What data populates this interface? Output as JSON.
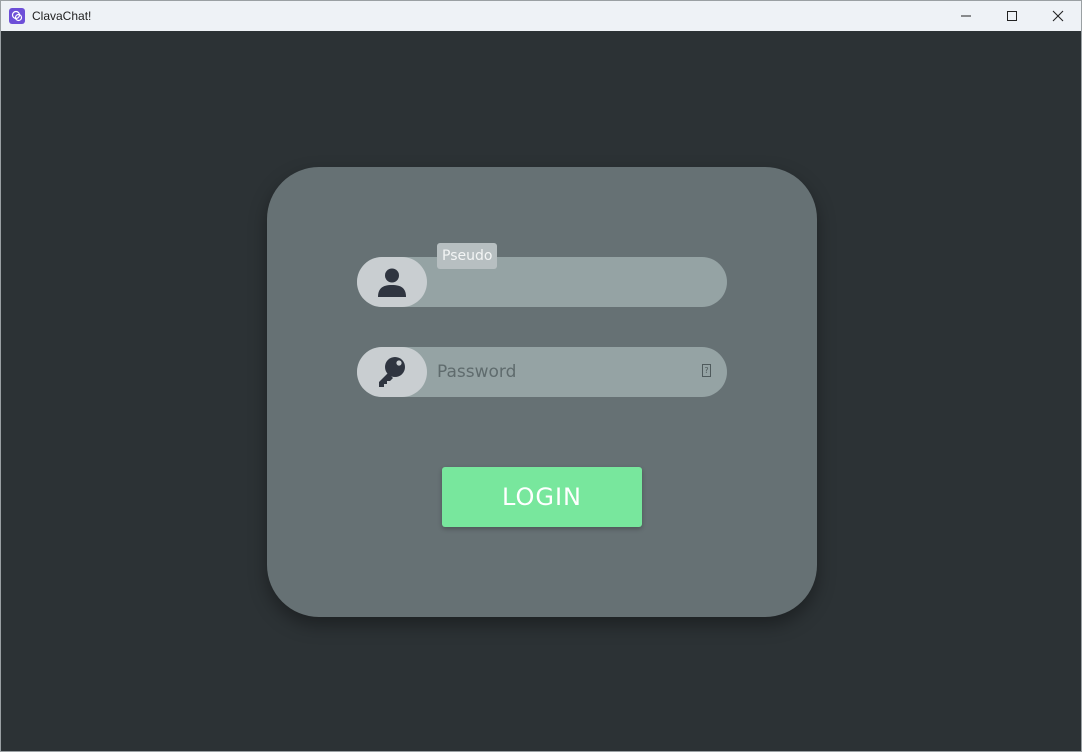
{
  "window": {
    "title": "ClavaChat!",
    "app_icon": "app-logo-icon"
  },
  "controls": {
    "minimize_icon": "minimize-icon",
    "maximize_icon": "maximize-icon",
    "close_icon": "close-icon"
  },
  "login": {
    "username_label": "Pseudo",
    "username_value": "",
    "username_icon": "user-icon",
    "password_placeholder": "Password",
    "password_value": "",
    "password_icon": "key-icon",
    "reveal_icon": "reveal-password-icon",
    "button_label": "LOGIN"
  },
  "colors": {
    "background": "#2c3235",
    "card": "#667174",
    "field": "#95a3a4",
    "icon_pill": "#c9ced1",
    "accent": "#78e79d"
  }
}
